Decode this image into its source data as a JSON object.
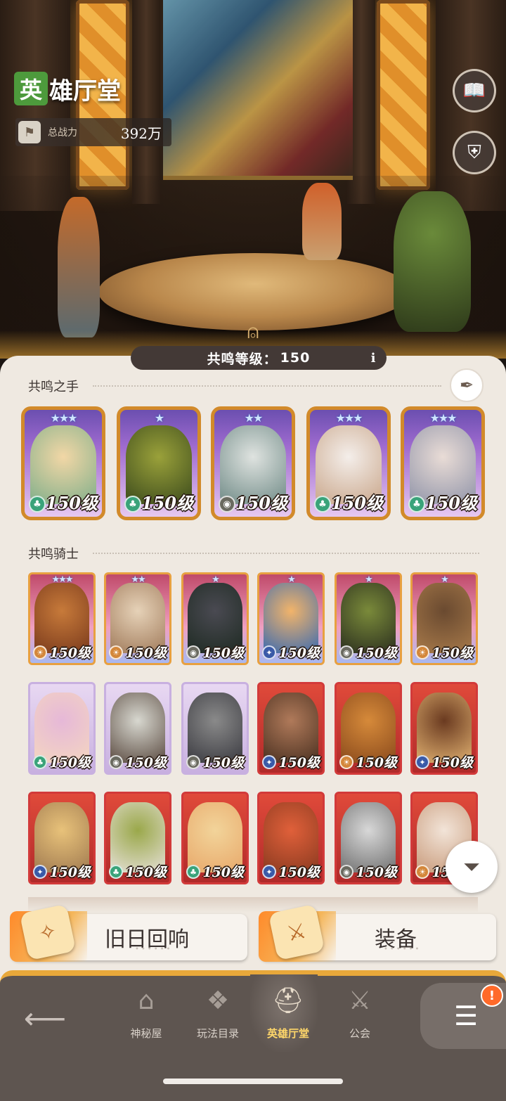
{
  "header": {
    "title_icon_char": "英",
    "title_rest": "雄厅堂",
    "power_label": "总战力",
    "power_value": "392万",
    "power_icon": "rank-banner-icon"
  },
  "side_buttons": [
    {
      "name": "codex-book-icon"
    },
    {
      "name": "helmet-emblem-icon"
    }
  ],
  "resonance": {
    "label": "共鸣等级：",
    "level": "150",
    "info": "i"
  },
  "sections": {
    "hands_label": "共鸣之手",
    "knights_label": "共鸣骑士"
  },
  "resonance_hands": [
    {
      "level": "150级",
      "stars": "★★★",
      "class_color": "#3aa37a",
      "class_icon": "leaf-class-icon",
      "portrait": [
        "#f2d7a6",
        "#7fae8a"
      ]
    },
    {
      "level": "150级",
      "stars": "★",
      "class_color": "#3aa37a",
      "class_icon": "leaf-class-icon",
      "portrait": [
        "#9aa13a",
        "#3b4a1c"
      ]
    },
    {
      "level": "150级",
      "stars": "★★",
      "class_color": "#6a6a60",
      "class_icon": "eye-class-icon",
      "portrait": [
        "#dfe3e0",
        "#6f8a86"
      ]
    },
    {
      "level": "150级",
      "stars": "★★★",
      "class_color": "#3aa37a",
      "class_icon": "leaf-class-icon",
      "portrait": [
        "#f4eeea",
        "#c9a68a"
      ]
    },
    {
      "level": "150级",
      "stars": "★★★",
      "class_color": "#3aa37a",
      "class_icon": "leaf-class-icon",
      "portrait": [
        "#e9dcd6",
        "#8f93a8"
      ]
    }
  ],
  "resonance_knights": [
    {
      "level": "150级",
      "stars": "★★★",
      "frame": "#e8a040",
      "class_color": "#d4873a",
      "class_icon": "sun-class-icon",
      "portrait": [
        "#c77a3a",
        "#7a3a1c"
      ]
    },
    {
      "level": "150级",
      "stars": "★★",
      "frame": "#e8a040",
      "class_color": "#d4873a",
      "class_icon": "sun-class-icon",
      "portrait": [
        "#e6d2b8",
        "#a07a5a"
      ]
    },
    {
      "level": "150级",
      "stars": "★",
      "frame": "#e8a040",
      "class_color": "#6a6a60",
      "class_icon": "eye-class-icon",
      "portrait": [
        "#4a4a52",
        "#1e2a22"
      ]
    },
    {
      "level": "150级",
      "stars": "★",
      "frame": "#e8a040",
      "class_color": "#3a5aa8",
      "class_icon": "star-class-icon",
      "portrait": [
        "#f2b46a",
        "#3a6ab0"
      ]
    },
    {
      "level": "150级",
      "stars": "★",
      "frame": "#e8a040",
      "class_color": "#6a6a60",
      "class_icon": "eye-class-icon",
      "portrait": [
        "#7a8a3a",
        "#2a2e1e"
      ]
    },
    {
      "level": "150级",
      "stars": "★",
      "frame": "#e8a040",
      "class_color": "#d4873a",
      "class_icon": "sun-class-icon",
      "portrait": [
        "#6a4a30",
        "#a87a4a"
      ]
    },
    {
      "level": "150级",
      "stars": "",
      "frame": "#c8b0e0",
      "class_color": "#3aa37a",
      "class_icon": "leaf-class-icon",
      "portrait": [
        "#e6b8d8",
        "#f4d6c0"
      ]
    },
    {
      "level": "150级",
      "stars": "",
      "frame": "#c8b0e0",
      "class_color": "#6a6a60",
      "class_icon": "eye-class-icon",
      "portrait": [
        "#d8d8d0",
        "#5a4a40"
      ]
    },
    {
      "level": "150级",
      "stars": "",
      "frame": "#c8b0e0",
      "class_color": "#6a6a60",
      "class_icon": "eye-class-icon",
      "portrait": [
        "#8a8a8a",
        "#3a3a40"
      ]
    },
    {
      "level": "150级",
      "stars": "",
      "frame": "#d23a3a",
      "class_color": "#3a5aa8",
      "class_icon": "star-class-icon",
      "portrait": [
        "#b07a5a",
        "#4a3020"
      ]
    },
    {
      "level": "150级",
      "stars": "",
      "frame": "#d23a3a",
      "class_color": "#d4873a",
      "class_icon": "sun-class-icon",
      "portrait": [
        "#d68a3a",
        "#8a4a1c"
      ]
    },
    {
      "level": "150级",
      "stars": "",
      "frame": "#d23a3a",
      "class_color": "#3a5aa8",
      "class_icon": "star-class-icon",
      "portrait": [
        "#6a3a20",
        "#e0b070"
      ]
    },
    {
      "level": "150级",
      "stars": "",
      "frame": "#d23a3a",
      "class_color": "#3a5aa8",
      "class_icon": "star-class-icon",
      "portrait": [
        "#e8c27a",
        "#a07a50"
      ]
    },
    {
      "level": "150级",
      "stars": "",
      "frame": "#d23a3a",
      "class_color": "#3aa37a",
      "class_icon": "leaf-class-icon",
      "portrait": [
        "#9aa84a",
        "#e6e0d8"
      ]
    },
    {
      "level": "150级",
      "stars": "",
      "frame": "#d23a3a",
      "class_color": "#3aa37a",
      "class_icon": "leaf-class-icon",
      "portrait": [
        "#f2d49a",
        "#e8a86a"
      ]
    },
    {
      "level": "150级",
      "stars": "",
      "frame": "#d23a3a",
      "class_color": "#3a5aa8",
      "class_icon": "star-class-icon",
      "portrait": [
        "#e0603a",
        "#8a3a20"
      ]
    },
    {
      "level": "150级",
      "stars": "",
      "frame": "#d23a3a",
      "class_color": "#6a6a60",
      "class_icon": "eye-class-icon",
      "portrait": [
        "#d8d8d8",
        "#707070"
      ]
    },
    {
      "level": "150级",
      "stars": "",
      "frame": "#d23a3a",
      "class_color": "#d4873a",
      "class_icon": "sun-class-icon",
      "portrait": [
        "#f2e4d8",
        "#c89a7a"
      ]
    }
  ],
  "bottom_buttons": {
    "echo_label": "旧日回响",
    "equipment_label": "装备"
  },
  "nav": {
    "back_icon": "back-arrow-icon",
    "items": [
      {
        "label": "神秘屋",
        "icon": "mystic-house-icon"
      },
      {
        "label": "玩法目录",
        "icon": "catalog-icon"
      },
      {
        "label": "英雄厅堂",
        "icon": "hero-hall-helmet-icon"
      },
      {
        "label": "公会",
        "icon": "guild-swords-icon"
      }
    ],
    "active_index": 2,
    "menu_badge": "!"
  },
  "colors": {
    "accent_orange": "#e8a83a",
    "active_nav_text": "#ffd76a",
    "panel_bg": "#efe9e1",
    "hero_green": "#4d9a3c"
  }
}
